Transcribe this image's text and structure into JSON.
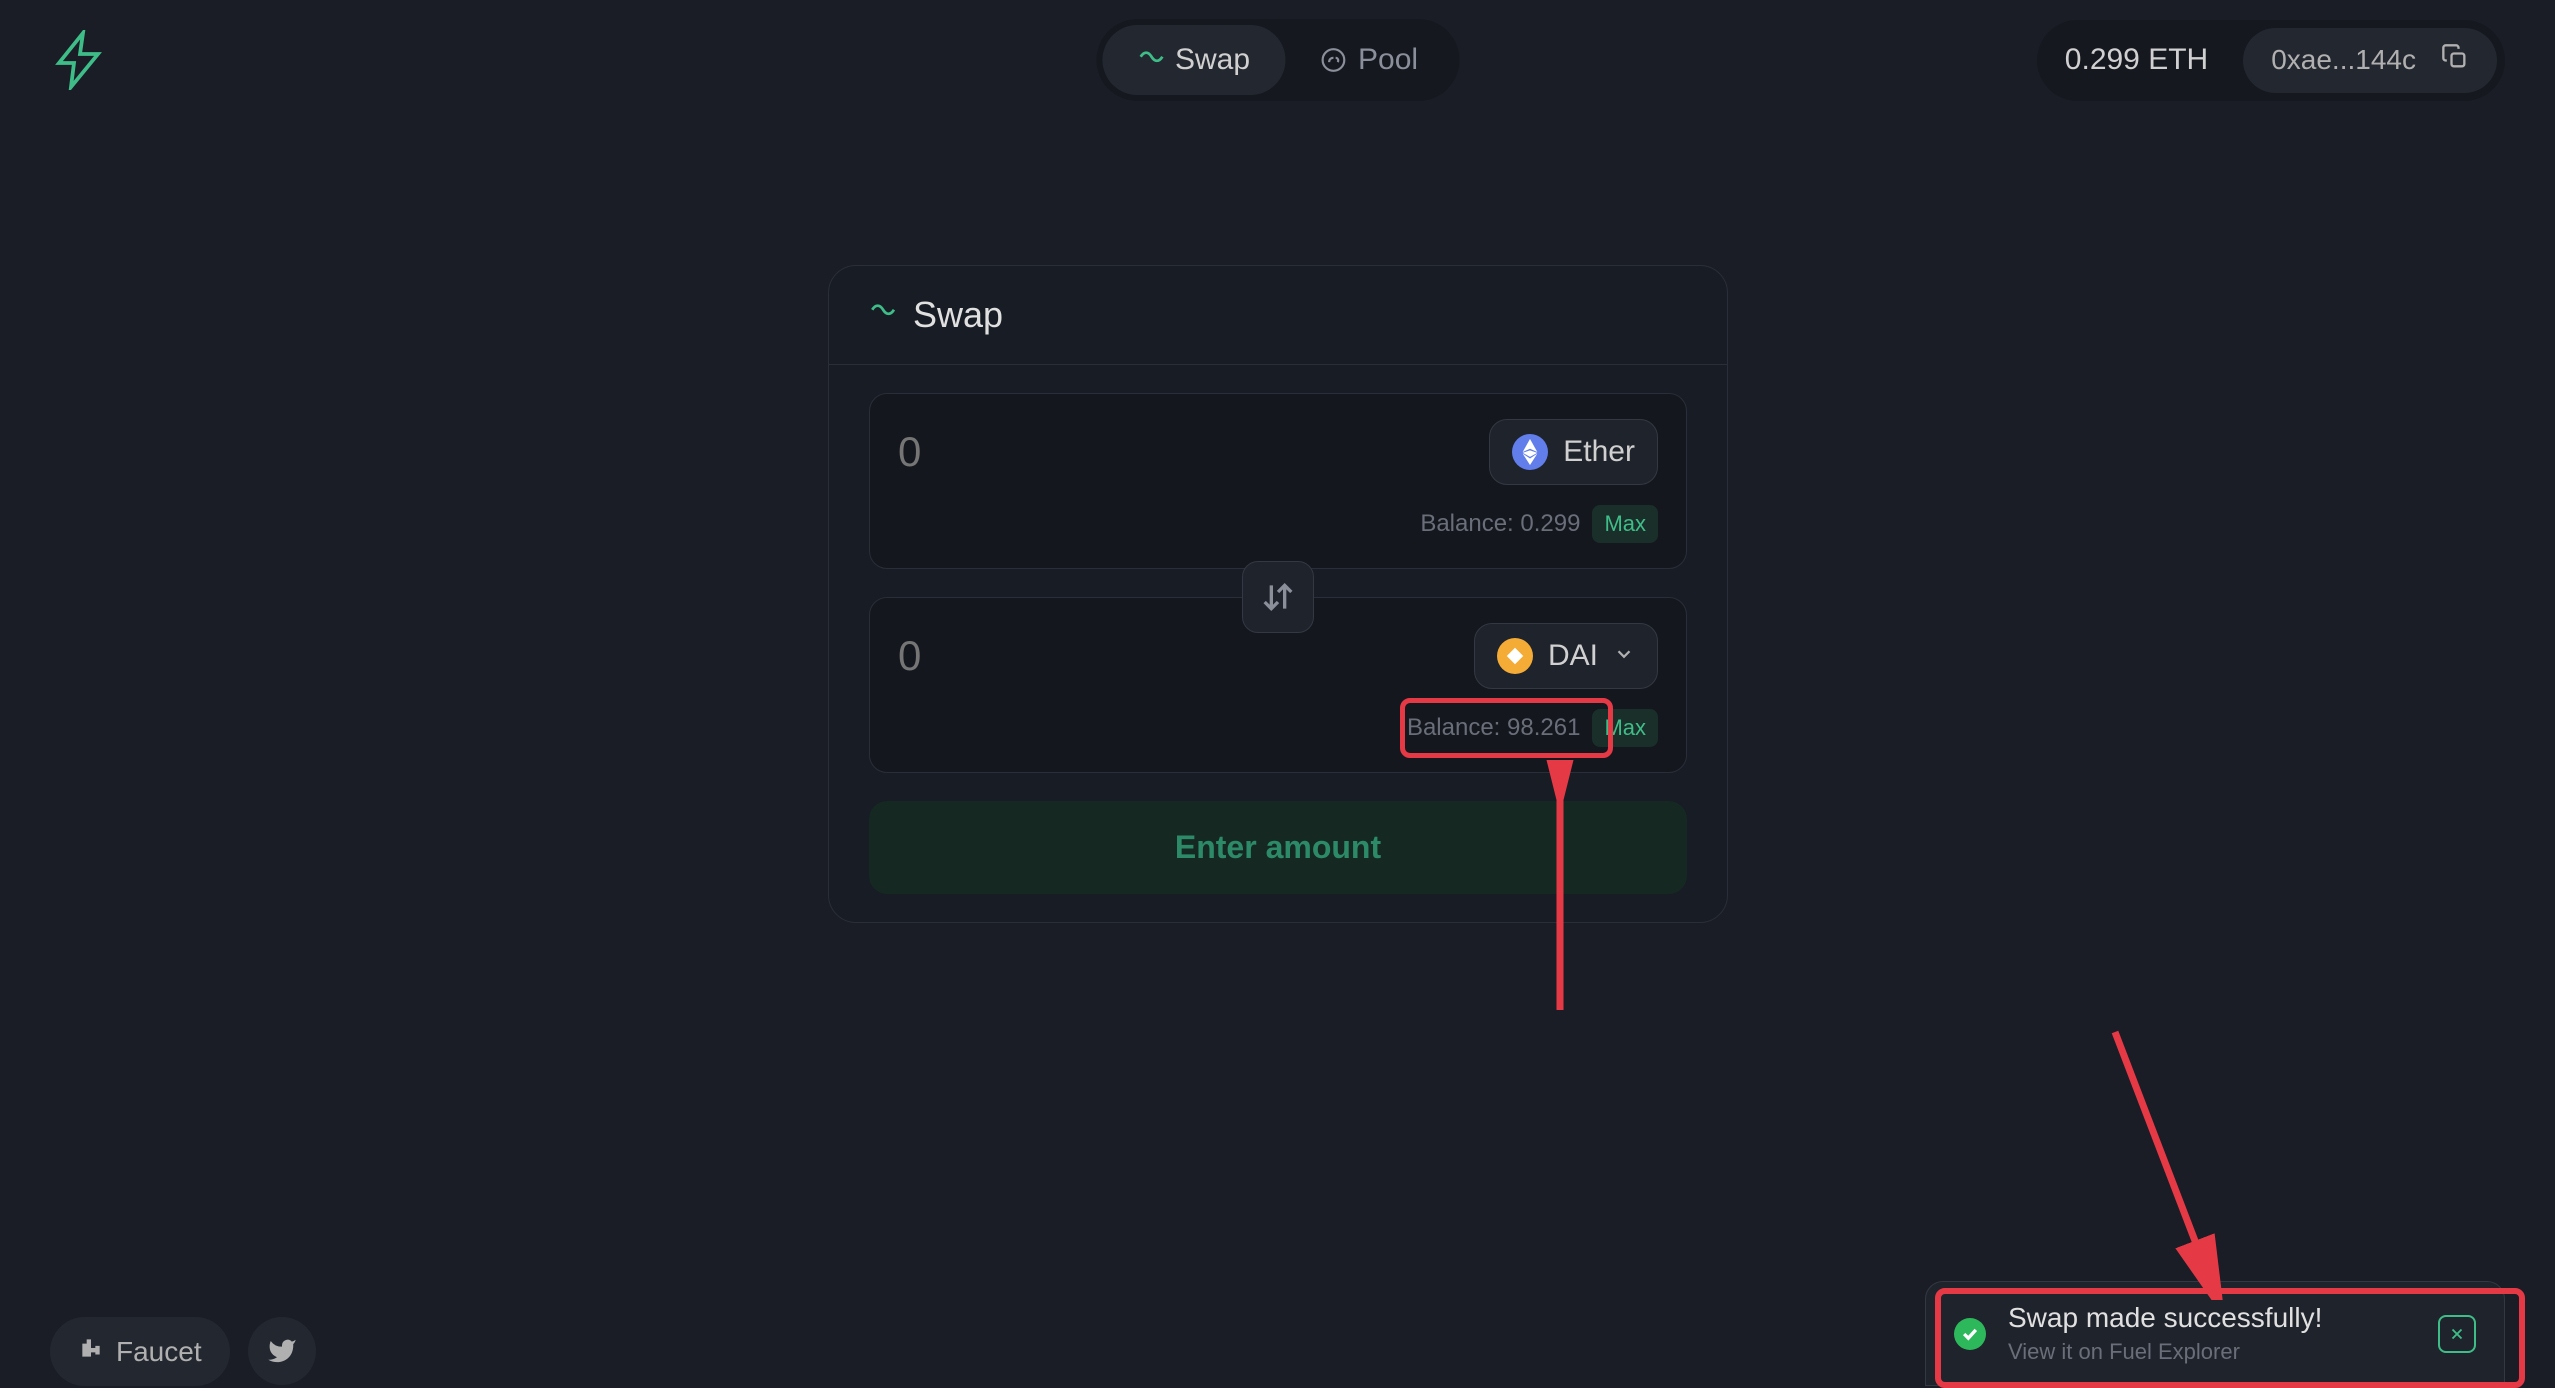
{
  "header": {
    "nav": {
      "swap": "Swap",
      "pool": "Pool"
    },
    "wallet": {
      "balance": "0.299 ETH",
      "address": "0xae...144c"
    }
  },
  "swap": {
    "title": "Swap",
    "from": {
      "amount_placeholder": "0",
      "token": "Ether",
      "balance_label": "Balance: 0.299",
      "max_label": "Max"
    },
    "to": {
      "amount_placeholder": "0",
      "token": "DAI",
      "balance_label": "Balance: 98.261",
      "max_label": "Max"
    },
    "submit_label": "Enter amount"
  },
  "toast": {
    "title": "Swap made successfully!",
    "subtitle": "View it on Fuel Explorer"
  },
  "footer": {
    "faucet": "Faucet"
  }
}
